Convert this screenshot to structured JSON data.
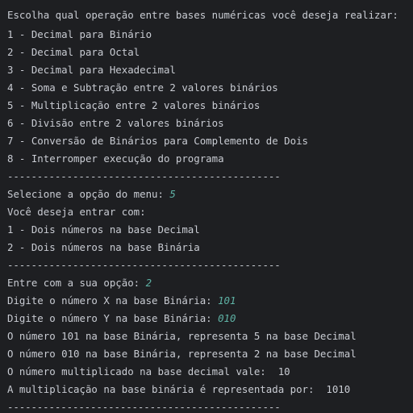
{
  "console": {
    "header": "Escolha qual operação entre bases numéricas você deseja realizar:",
    "menu": [
      "1 - Decimal para Binário",
      "2 - Decimal para Octal",
      "3 - Decimal para Hexadecimal",
      "4 - Soma e Subtração entre 2 valores binários",
      "5 - Multiplicação entre 2 valores binários",
      "6 - Divisão entre 2 valores binários",
      "7 - Conversão de Binários para Complemento de Dois",
      "8 - Interromper execução do programa"
    ],
    "separator": "----------------------------------------------",
    "menu_prompt": "Selecione a opção do menu: ",
    "menu_input": "5",
    "entry_question": "Você deseja entrar com:",
    "entry_options": [
      "1 - Dois números na base Decimal",
      "2 - Dois números na base Binária"
    ],
    "option_prompt": "Entre com a sua opção: ",
    "option_input": "2",
    "x_prompt": "Digite o número X na base Binária: ",
    "x_input": "101",
    "y_prompt": "Digite o número Y na base Binária: ",
    "y_input": "010",
    "result_x": "O número 101 na base Binária, representa 5 na base Decimal",
    "result_y": "O número 010 na base Binária, representa 2 na base Decimal",
    "result_decimal": "O número multiplicado na base decimal vale:  10",
    "result_binary": "A multiplicação na base binária é representada por:  1010"
  },
  "colors": {
    "background": "#1e1f22",
    "text": "#c9ccd3",
    "user_input": "#5fb3a6"
  }
}
